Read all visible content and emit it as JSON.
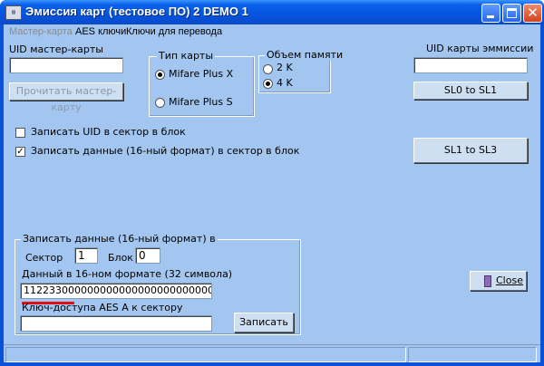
{
  "window": {
    "title": "Эмиссия карт (тестовое ПО) 2  DEMO 1",
    "icon": "app-window-icon"
  },
  "menu": {
    "items": [
      "Мастер-карта",
      "AES ключи",
      "Ключи для перевода"
    ]
  },
  "master": {
    "uid_label": "UID мастер-карты",
    "uid_value": "",
    "read_button": "Прочитать мастер-карту"
  },
  "card_type": {
    "title": "Тип карты",
    "option1": "Mifare Plus X",
    "option2": "Mifare Plus S",
    "selected": "Mifare Plus X"
  },
  "memory": {
    "title": "Объем памяти",
    "option1": "2 K",
    "option2": "4 K",
    "selected": "4 K"
  },
  "emission": {
    "uid_label": "UID карты эммиссии",
    "uid_value": "",
    "sl0_button": "SL0 to SL1",
    "sl1_button": "SL1 to SL3"
  },
  "checkboxes": {
    "write_uid": {
      "label": "Записать UID в сектор в блок",
      "checked": false
    },
    "write_data": {
      "label": "Записать данные (16-ный формат) в сектор в блок",
      "checked": true
    }
  },
  "write_group": {
    "title": "Записать данные (16-ный формат) в",
    "sector_label": "Сектор",
    "sector_value": "1",
    "block_label": "Блок",
    "block_value": "0",
    "hex_label": "Данный в 16-ном формате (32 символа)",
    "hex_value": "11223300000000000000000000000000",
    "key_label": "Ключ-доступа AES A к сектору",
    "key_value": "",
    "write_button": "Записать"
  },
  "close_button": {
    "label": "Close",
    "icon": "door-exit-icon"
  },
  "colors": {
    "client_bg": "#a3c6f0",
    "titlebar": "#0a5fe8",
    "highlight": "#e01010"
  }
}
